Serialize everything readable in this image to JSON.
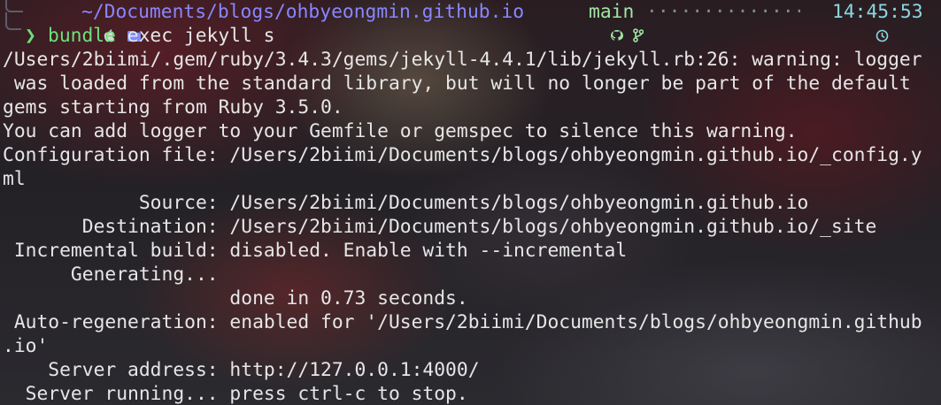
{
  "prompt": {
    "apple_icon": "",
    "folder_icon": "▬",
    "path": "~/Documents/blogs/ohbyeongmin.github.io",
    "github_icon": "github-icon",
    "branch_icon": "ᚠ",
    "branch": "main",
    "clock_icon": "◷",
    "time": "14:45:53",
    "chevron": "❯",
    "command_name": "bundle",
    "command_args": " exec jekyll s"
  },
  "output": {
    "lines": [
      "/Users/2biimi/.gem/ruby/3.4.3/gems/jekyll-4.4.1/lib/jekyll.rb:26: warning: logger",
      " was loaded from the standard library, but will no longer be part of the default",
      "gems starting from Ruby 3.5.0.",
      "You can add logger to your Gemfile or gemspec to silence this warning.",
      "Configuration file: /Users/2biimi/Documents/blogs/ohbyeongmin.github.io/_config.y",
      "ml",
      "            Source: /Users/2biimi/Documents/blogs/ohbyeongmin.github.io",
      "       Destination: /Users/2biimi/Documents/blogs/ohbyeongmin.github.io/_site",
      " Incremental build: disabled. Enable with --incremental",
      "      Generating...",
      "                    done in 0.73 seconds.",
      " Auto-regeneration: enabled for '/Users/2biimi/Documents/blogs/ohbyeongmin.github",
      ".io'",
      "    Server address: http://127.0.0.1:4000/",
      "  Server running... press ctrl-c to stop."
    ]
  }
}
